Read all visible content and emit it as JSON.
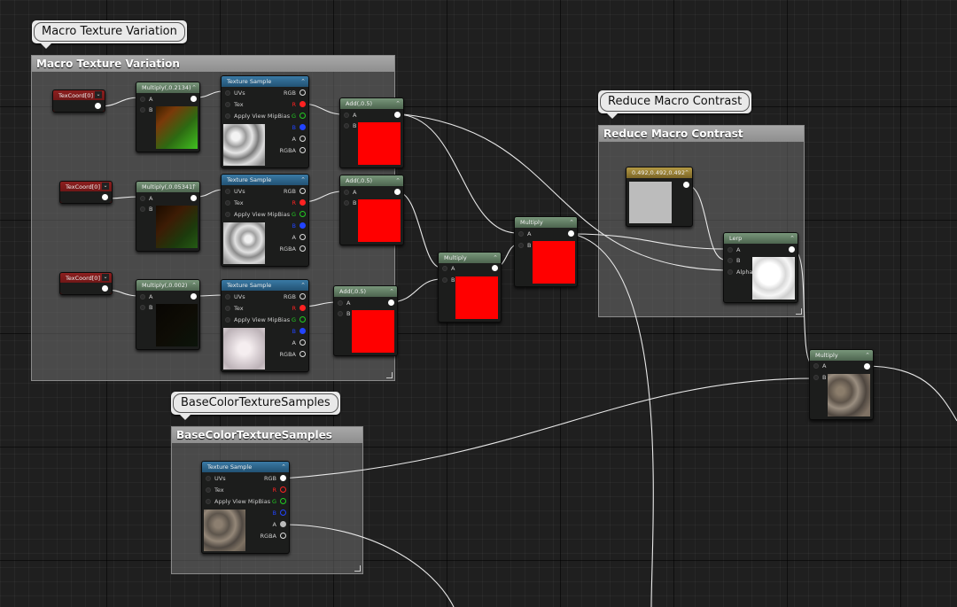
{
  "comments": {
    "macro": {
      "bubble": "Macro Texture Variation",
      "header": "Macro Texture Variation"
    },
    "reduce": {
      "bubble": "Reduce Macro Contrast",
      "header": "Reduce Macro Contrast"
    },
    "basecolor": {
      "bubble": "BaseColorTextureSamples",
      "header": "BaseColorTextureSamples"
    }
  },
  "texcoord": {
    "label": "TexCoord[0]"
  },
  "multiply_nodes": {
    "m1": "Multiply(,0.2134)",
    "m2": "Multiply(,0.05341)",
    "m3": "Multiply(,0.002)",
    "plain": "Multiply"
  },
  "add_node": {
    "label": "Add(,0.5)"
  },
  "texture_sample": {
    "title": "Texture Sample",
    "inputs": [
      "UVs",
      "Tex",
      "Apply View MipBias"
    ],
    "outputs": [
      "RGB",
      "R",
      "G",
      "B",
      "A",
      "RGBA"
    ]
  },
  "pins": {
    "a": "A",
    "b": "B",
    "alpha": "Alpha"
  },
  "constant_node": {
    "label": "0.492,0.492,0.492"
  },
  "lerp_node": {
    "label": "Lerp"
  },
  "colors": {
    "red_preview": "#ff0000",
    "output_r": "#ff2222",
    "output_g": "#22cc22",
    "output_b": "#2244ff",
    "constant_gray": "#bcbcbc",
    "texcoord_header": "#8d1f1f",
    "math_header": "#5f7b61",
    "texture_header": "#2e6791",
    "constant_header": "#9a8237"
  },
  "icons": [
    "chevron-up-icon",
    "dropdown-arrow-icon",
    "input-pin-icon",
    "output-pin-icon",
    "resize-grip-icon"
  ]
}
